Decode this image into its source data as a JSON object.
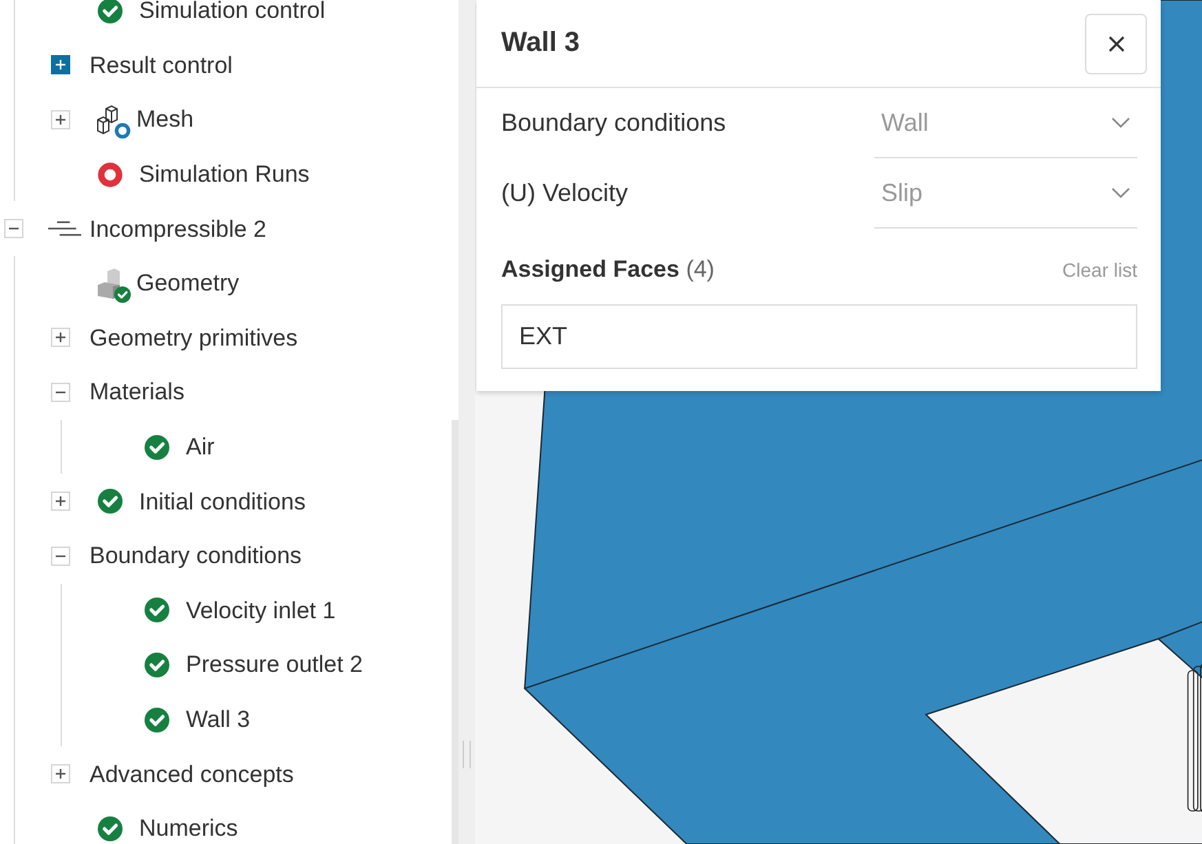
{
  "tree": [
    {
      "children": [
        {
          "label": "Simulation control",
          "kind": "check"
        },
        {
          "label": "Result control",
          "expanded": false,
          "toggle_highlighted": true
        },
        {
          "label": "Mesh",
          "expanded": false,
          "toggle_highlighted": false,
          "kind": "mesh"
        },
        {
          "label": "Simulation Runs",
          "kind": "error"
        }
      ]
    },
    {
      "label": "Incompressible 2",
      "expanded": true,
      "toggle_highlighted": false,
      "kind": "physics",
      "children": [
        {
          "label": "Geometry",
          "kind": "geometry"
        },
        {
          "label": "Geometry primitives",
          "expanded": false,
          "toggle_highlighted": false
        },
        {
          "label": "Materials",
          "expanded": true,
          "toggle_highlighted": false,
          "children": [
            {
              "label": "Air",
              "kind": "check"
            }
          ]
        },
        {
          "label": "Initial conditions",
          "expanded": false,
          "toggle_highlighted": false,
          "kind": "check"
        },
        {
          "label": "Boundary conditions",
          "expanded": true,
          "toggle_highlighted": false,
          "children": [
            {
              "label": "Velocity inlet 1",
              "kind": "check"
            },
            {
              "label": "Pressure outlet 2",
              "kind": "check"
            },
            {
              "label": "Wall 3",
              "kind": "check"
            }
          ]
        },
        {
          "label": "Advanced concepts",
          "expanded": false,
          "toggle_highlighted": false
        },
        {
          "label": "Numerics",
          "kind": "check"
        }
      ]
    }
  ],
  "panel": {
    "title": "Wall 3",
    "fields": [
      {
        "label": "Boundary conditions",
        "value": "Wall"
      },
      {
        "label": "(U) Velocity",
        "value": "Slip"
      }
    ],
    "assigned_faces": {
      "label": "Assigned Faces",
      "count": "(4)",
      "action": "Clear list",
      "items": [
        "EXT"
      ]
    }
  }
}
